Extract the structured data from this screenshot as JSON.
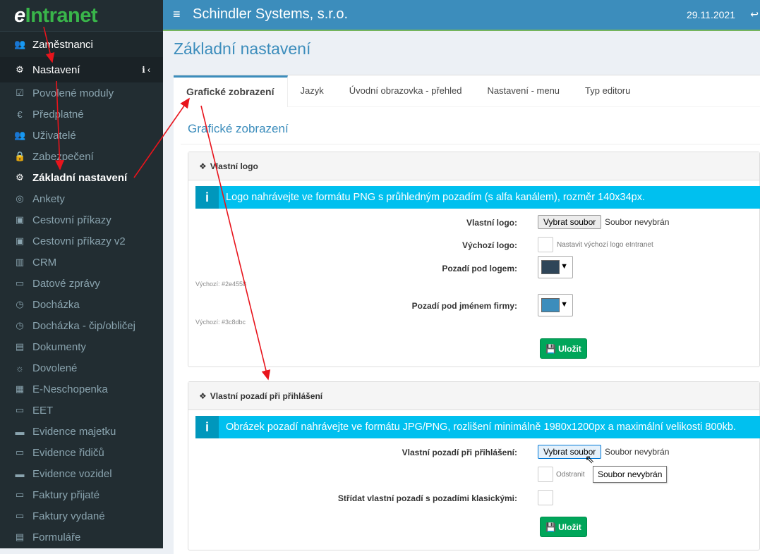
{
  "sidebar": {
    "logo_e": "e",
    "logo_text": "Intranet",
    "items": [
      {
        "label": "Zaměstnanci",
        "icon": "users-icon",
        "glyph": "👥"
      },
      {
        "label": "Nastavení",
        "icon": "cogs-icon",
        "glyph": "⚙"
      },
      {
        "label": "Povolené moduly",
        "icon": "check-square-icon",
        "glyph": "☑"
      },
      {
        "label": "Předplatné",
        "icon": "euro-icon",
        "glyph": "€"
      },
      {
        "label": "Uživatelé",
        "icon": "users-icon",
        "glyph": "👥"
      },
      {
        "label": "Zabezpečení",
        "icon": "lock-icon",
        "glyph": "🔒"
      },
      {
        "label": "Základní nastavení",
        "icon": "cogs-icon",
        "glyph": "⚙"
      },
      {
        "label": "Ankety",
        "icon": "bullseye-icon",
        "glyph": "◎"
      },
      {
        "label": "Cestovní příkazy",
        "icon": "train-icon",
        "glyph": "▣"
      },
      {
        "label": "Cestovní příkazy v2",
        "icon": "train-icon",
        "glyph": "▣"
      },
      {
        "label": "CRM",
        "icon": "building-icon",
        "glyph": "▥"
      },
      {
        "label": "Datové zprávy",
        "icon": "inbox-icon",
        "glyph": "▭"
      },
      {
        "label": "Docházka",
        "icon": "clock-icon",
        "glyph": "◷"
      },
      {
        "label": "Docházka - čip/obličej",
        "icon": "clock-icon",
        "glyph": "◷"
      },
      {
        "label": "Dokumenty",
        "icon": "word-file-icon",
        "glyph": "▤"
      },
      {
        "label": "Dovolené",
        "icon": "sun-icon",
        "glyph": "☼"
      },
      {
        "label": "E-Neschopenka",
        "icon": "medical-file-icon",
        "glyph": "▦"
      },
      {
        "label": "EET",
        "icon": "monitor-icon",
        "glyph": "▭"
      },
      {
        "label": "Evidence majetku",
        "icon": "archive-icon",
        "glyph": "▬"
      },
      {
        "label": "Evidence řidičů",
        "icon": "id-card-icon",
        "glyph": "▭"
      },
      {
        "label": "Evidence vozidel",
        "icon": "car-icon",
        "glyph": "▬"
      },
      {
        "label": "Faktury přijaté",
        "icon": "credit-card-icon",
        "glyph": "▭"
      },
      {
        "label": "Faktury vydané",
        "icon": "credit-card-icon",
        "glyph": "▭"
      },
      {
        "label": "Formuláře",
        "icon": "list-icon",
        "glyph": "▤"
      }
    ],
    "info_icon": "ℹ",
    "chevron": "‹"
  },
  "topbar": {
    "menu_glyph": "≡",
    "company": "Schindler Systems, s.r.o.",
    "date": "29.11.2021",
    "share_glyph": "↩"
  },
  "page": {
    "title": "Základní nastavení",
    "tabs": [
      "Grafické zobrazení",
      "Jazyk",
      "Úvodní obrazovka - přehled",
      "Nastavení - menu",
      "Typ editoru"
    ],
    "section_title": "Grafické zobrazení"
  },
  "logo_panel": {
    "header": "Vlastní logo",
    "info": "Logo nahrávejte ve formátu PNG s průhledným pozadím (s alfa kanálem), rozměr 140x34px.",
    "custom_logo_label": "Vlastní logo:",
    "file_button": "Vybrat soubor",
    "file_status": "Soubor nevybrán",
    "default_logo_label": "Výchozí logo:",
    "default_logo_hint": "Nastavit výchozí logo eIntranet",
    "bg_logo_label": "Pozadí pod logem:",
    "bg_logo_default": "Výchozí: #2e4558",
    "bg_logo_color": "#2e4558",
    "bg_name_label": "Pozadí pod jménem firmy:",
    "bg_name_default": "Výchozí: #3c8dbc",
    "bg_name_color": "#3c8dbc",
    "save": "Uložit"
  },
  "bg_panel": {
    "header": "Vlastní pozadí při přihlášení",
    "info": "Obrázek pozadí nahrávejte ve formátu JPG/PNG, rozlišení minimálně 1980x1200px a maximální velikosti 800kb.",
    "custom_bg_label": "Vlastní pozadí při přihlášení:",
    "file_button": "Vybrat soubor",
    "file_status": "Soubor nevybrán",
    "remove_label": "Odstranit",
    "tooltip": "Soubor nevybrán",
    "alternate_label": "Střídat vlastní pozadí s pozadími klasickými:",
    "save": "Uložit"
  },
  "colors": {
    "primary": "#3c8dbc",
    "sidebar": "#222d32",
    "success": "#00a65a",
    "info": "#00c0ef",
    "annotation": "#e8141c"
  }
}
